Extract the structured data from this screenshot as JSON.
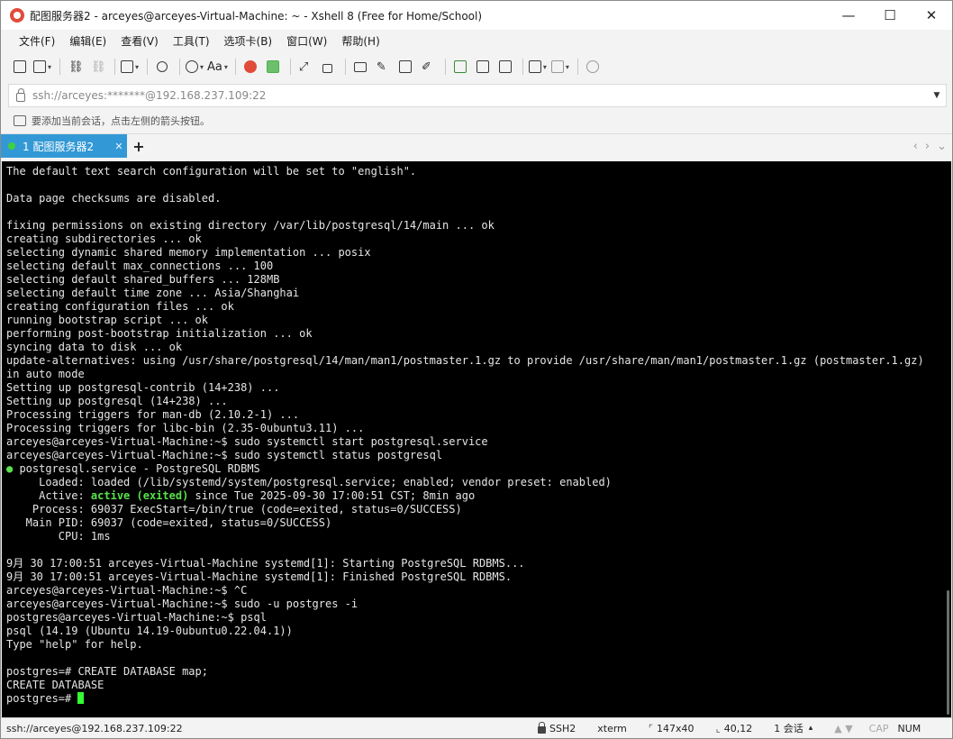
{
  "window": {
    "title": "配图服务器2 - arceyes@arceyes-Virtual-Machine: ~ - Xshell 8 (Free for Home/School)",
    "minimize": "—",
    "maximize": "☐",
    "close": "✕"
  },
  "menu": [
    "文件(F)",
    "编辑(E)",
    "查看(V)",
    "工具(T)",
    "选项卡(B)",
    "窗口(W)",
    "帮助(H)"
  ],
  "toolbar": {
    "font_label": "Aa",
    "icons": [
      "new-session-icon",
      "open-folder-icon",
      "reconnect-icon",
      "disconnect-icon",
      "new-tab-icon",
      "search-icon",
      "globe-icon",
      "font-icon",
      "xshell-icon",
      "xftp-icon",
      "fullscreen-icon",
      "lock-icon",
      "keyboard-icon",
      "script-icon",
      "transfer-icon",
      "log-icon",
      "compose-icon",
      "tunnel-icon",
      "layout-icon",
      "help-icon"
    ]
  },
  "address": {
    "text": "ssh://arceyes:*******@192.168.237.109:22"
  },
  "hint": {
    "text": "要添加当前会话，点击左侧的箭头按钮。"
  },
  "tabs": [
    {
      "label": "1 配图服务器2",
      "active": true,
      "status_color": "#3fd23f"
    }
  ],
  "tab_add": "+",
  "tab_nav": {
    "prev": "‹",
    "next": "›",
    "menu": "⌄"
  },
  "terminal": {
    "lines": [
      [
        {
          "t": "The default text search configuration will be set to \"english\"."
        }
      ],
      [
        {
          "t": ""
        }
      ],
      [
        {
          "t": "Data page checksums are disabled."
        }
      ],
      [
        {
          "t": ""
        }
      ],
      [
        {
          "t": "fixing permissions on existing directory /var/lib/postgresql/14/main ... ok"
        }
      ],
      [
        {
          "t": "creating subdirectories ... ok"
        }
      ],
      [
        {
          "t": "selecting dynamic shared memory implementation ... posix"
        }
      ],
      [
        {
          "t": "selecting default max_connections ... 100"
        }
      ],
      [
        {
          "t": "selecting default shared_buffers ... 128MB"
        }
      ],
      [
        {
          "t": "selecting default time zone ... Asia/Shanghai"
        }
      ],
      [
        {
          "t": "creating configuration files ... ok"
        }
      ],
      [
        {
          "t": "running bootstrap script ... ok"
        }
      ],
      [
        {
          "t": "performing post-bootstrap initialization ... ok"
        }
      ],
      [
        {
          "t": "syncing data to disk ... ok"
        }
      ],
      [
        {
          "t": "update-alternatives: using /usr/share/postgresql/14/man/man1/postmaster.1.gz to provide /usr/share/man/man1/postmaster.1.gz (postmaster.1.gz)"
        }
      ],
      [
        {
          "t": "in auto mode"
        }
      ],
      [
        {
          "t": "Setting up postgresql-contrib (14+238) ..."
        }
      ],
      [
        {
          "t": "Setting up postgresql (14+238) ..."
        }
      ],
      [
        {
          "t": "Processing triggers for man-db (2.10.2-1) ..."
        }
      ],
      [
        {
          "t": "Processing triggers for libc-bin (2.35-0ubuntu3.11) ..."
        }
      ],
      [
        {
          "t": "arceyes@arceyes-Virtual-Machine:~$ sudo systemctl start postgresql.service"
        }
      ],
      [
        {
          "t": "arceyes@arceyes-Virtual-Machine:~$ sudo systemctl status postgresql"
        }
      ],
      [
        {
          "t": "●",
          "c": "green"
        },
        {
          "t": " postgresql.service - PostgreSQL RDBMS"
        }
      ],
      [
        {
          "t": "     Loaded: loaded (/lib/systemd/system/postgresql.service; enabled; vendor preset: enabled)"
        }
      ],
      [
        {
          "t": "     Active: "
        },
        {
          "t": "active (exited)",
          "c": "bold-green"
        },
        {
          "t": " since Tue 2025-09-30 17:00:51 CST; 8min ago"
        }
      ],
      [
        {
          "t": "    Process: 69037 ExecStart=/bin/true (code=exited, status=0/SUCCESS)"
        }
      ],
      [
        {
          "t": "   Main PID: 69037 (code=exited, status=0/SUCCESS)"
        }
      ],
      [
        {
          "t": "        CPU: 1ms"
        }
      ],
      [
        {
          "t": ""
        }
      ],
      [
        {
          "t": "9月 30 17:00:51 arceyes-Virtual-Machine systemd[1]: Starting PostgreSQL RDBMS..."
        }
      ],
      [
        {
          "t": "9月 30 17:00:51 arceyes-Virtual-Machine systemd[1]: Finished PostgreSQL RDBMS."
        }
      ],
      [
        {
          "t": "arceyes@arceyes-Virtual-Machine:~$ ^C"
        }
      ],
      [
        {
          "t": "arceyes@arceyes-Virtual-Machine:~$ sudo -u postgres -i"
        }
      ],
      [
        {
          "t": "postgres@arceyes-Virtual-Machine:~$ psql"
        }
      ],
      [
        {
          "t": "psql (14.19 (Ubuntu 14.19-0ubuntu0.22.04.1))"
        }
      ],
      [
        {
          "t": "Type \"help\" for help."
        }
      ],
      [
        {
          "t": ""
        }
      ],
      [
        {
          "t": "postgres=# CREATE DATABASE map;"
        }
      ],
      [
        {
          "t": "CREATE DATABASE"
        }
      ],
      [
        {
          "t": "postgres=# "
        },
        {
          "t": "",
          "c": "cursor"
        }
      ]
    ]
  },
  "status": {
    "connection": "ssh://arceyes@192.168.237.109:22",
    "protocol": "SSH2",
    "terminal_type": "xterm",
    "size": "147x40",
    "cursor_pos": "40,12",
    "sessions": "1 会话",
    "cap": "CAP",
    "num": "NUM"
  }
}
